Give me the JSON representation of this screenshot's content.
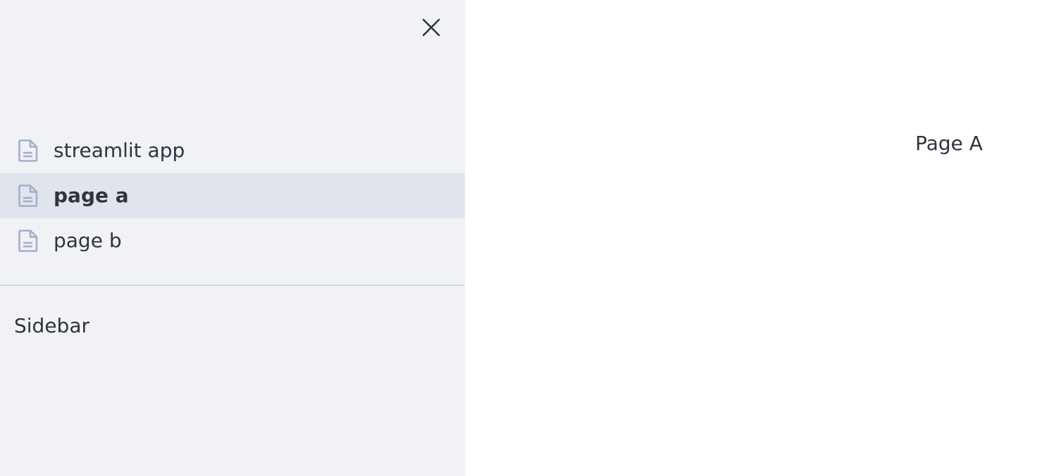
{
  "sidebar": {
    "close_icon": "close-icon",
    "nav": [
      {
        "label": "streamlit app",
        "icon": "document-icon",
        "active": false
      },
      {
        "label": "page a",
        "icon": "document-icon",
        "active": true
      },
      {
        "label": "page b",
        "icon": "document-icon",
        "active": false
      }
    ],
    "text": "Sidebar"
  },
  "main": {
    "text": "Page A"
  },
  "colors": {
    "sidebar_bg": "#f0f2f6",
    "active_item_bg": "#e0e5ed",
    "icon": "#a3b0c8",
    "text": "#31333f"
  }
}
